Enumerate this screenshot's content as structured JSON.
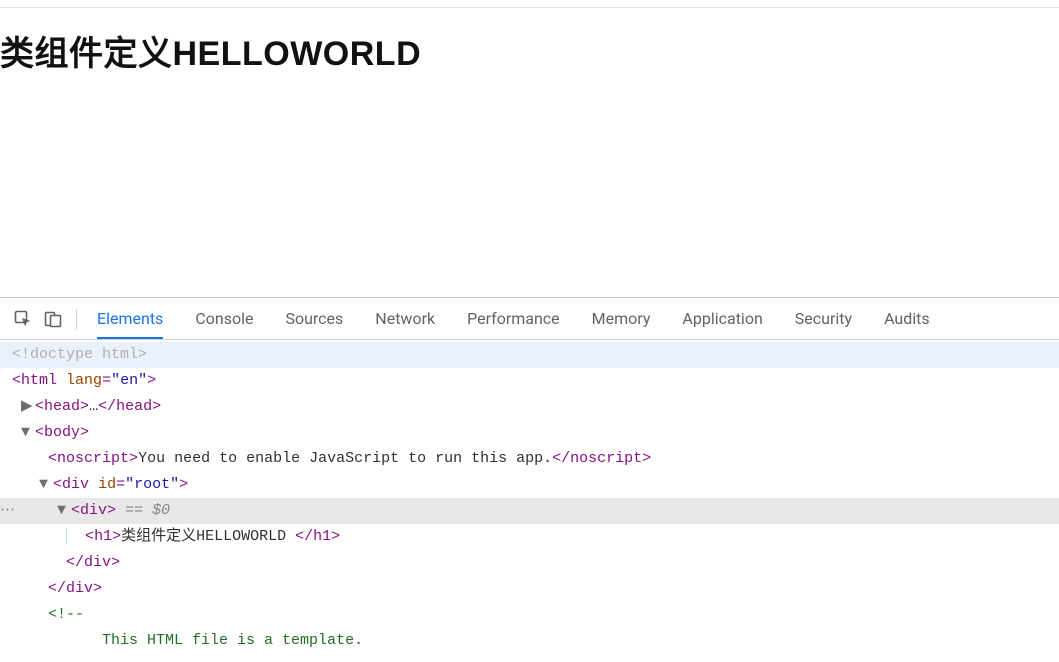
{
  "page": {
    "heading": "类组件定义HELLOWORLD"
  },
  "devtools": {
    "tabs": [
      {
        "label": "Elements",
        "active": true
      },
      {
        "label": "Console",
        "active": false
      },
      {
        "label": "Sources",
        "active": false
      },
      {
        "label": "Network",
        "active": false
      },
      {
        "label": "Performance",
        "active": false
      },
      {
        "label": "Memory",
        "active": false
      },
      {
        "label": "Application",
        "active": false
      },
      {
        "label": "Security",
        "active": false
      },
      {
        "label": "Audits",
        "active": false
      }
    ],
    "elements_tree": {
      "doctype": "<!doctype html>",
      "html_open": {
        "tag": "html",
        "attr": {
          "name": "lang",
          "value": "en"
        }
      },
      "head": {
        "open": "head",
        "ellipsis": "…",
        "close": "/head"
      },
      "body_open": "body",
      "noscript": {
        "tag": "noscript",
        "text": "You need to enable JavaScript to run this app.",
        "close": "/noscript"
      },
      "div_root": {
        "tag": "div",
        "attr": {
          "name": "id",
          "value": "root"
        }
      },
      "div_inner": {
        "tag": "div",
        "marker": " == $0"
      },
      "h1": {
        "tag": "h1",
        "text": "类组件定义HELLOWORLD ",
        "close": "/h1"
      },
      "div_inner_close": "/div",
      "div_root_close": "/div",
      "comment_start": "<!--",
      "comment_line": "      This HTML file is a template."
    }
  }
}
